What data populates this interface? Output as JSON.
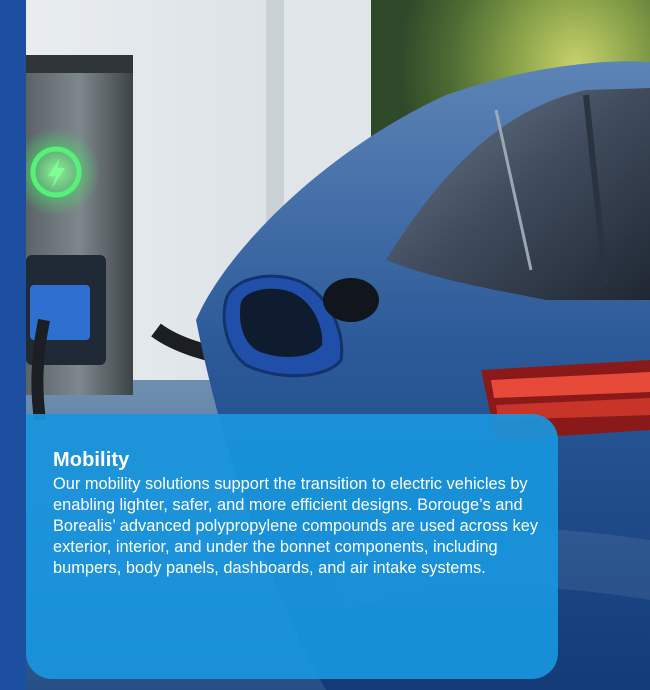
{
  "card": {
    "title": "Mobility",
    "body": "Our mobility solutions support the transition to electric vehicles by enabling lighter, safer, and more efficient designs. Borouge’s and Borealis’ advanced polypropylene compounds are used across key exterior, interior, and under the bonnet components, including bumpers, body panels, dashboards, and air intake systems."
  },
  "colors": {
    "brand_blue": "#1d4fa0",
    "card_blue": "#1896de",
    "card_text": "#ffffff",
    "charger_glow": "#4be36c"
  },
  "icons": {
    "charger": "lightning-bolt-icon"
  }
}
